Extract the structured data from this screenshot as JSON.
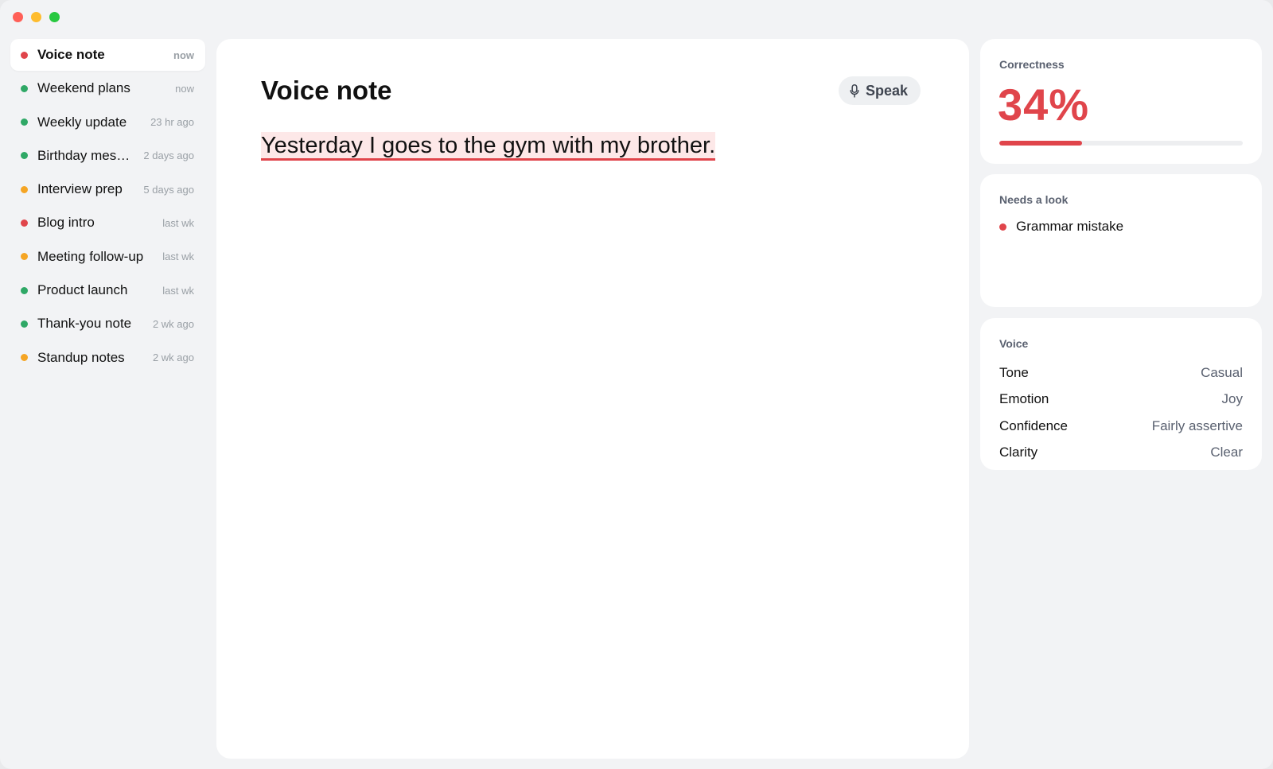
{
  "window": {
    "controls": [
      "close",
      "minimize",
      "zoom"
    ]
  },
  "sidebar": {
    "items": [
      {
        "title": "Voice note",
        "time": "now",
        "status_color": "#e0454b",
        "active": true
      },
      {
        "title": "Weekend plans",
        "time": "now",
        "status_color": "#2fa866"
      },
      {
        "title": "Weekly update",
        "time": "23 hr ago",
        "status_color": "#2fa866"
      },
      {
        "title": "Birthday mess…",
        "time": "2 days ago",
        "status_color": "#2fa866"
      },
      {
        "title": "Interview prep",
        "time": "5 days ago",
        "status_color": "#f5a524"
      },
      {
        "title": "Blog intro",
        "time": "last wk",
        "status_color": "#e0454b"
      },
      {
        "title": "Meeting follow-up",
        "time": "last wk",
        "status_color": "#f5a524"
      },
      {
        "title": "Product launch",
        "time": "last wk",
        "status_color": "#2fa866"
      },
      {
        "title": "Thank-you note",
        "time": "2 wk ago",
        "status_color": "#2fa866"
      },
      {
        "title": "Standup notes",
        "time": "2 wk ago",
        "status_color": "#f5a524"
      }
    ]
  },
  "editor": {
    "title": "Voice note",
    "speak_label": "Speak",
    "speak_icon": "microphone-icon",
    "body": "Yesterday I goes to the gym with my brother."
  },
  "panel": {
    "correctness": {
      "label": "Correctness",
      "score_text": "34%",
      "score_fraction": 0.34,
      "accent": "#e0454b"
    },
    "needs_a_look": {
      "label": "Needs a look",
      "issues": [
        {
          "label": "Grammar mistake",
          "color": "#e0454b"
        }
      ]
    },
    "voice": {
      "label": "Voice",
      "rows": [
        {
          "key": "Tone",
          "value": "Casual"
        },
        {
          "key": "Emotion",
          "value": "Joy"
        },
        {
          "key": "Confidence",
          "value": "Fairly assertive"
        },
        {
          "key": "Clarity",
          "value": "Clear"
        }
      ]
    }
  }
}
